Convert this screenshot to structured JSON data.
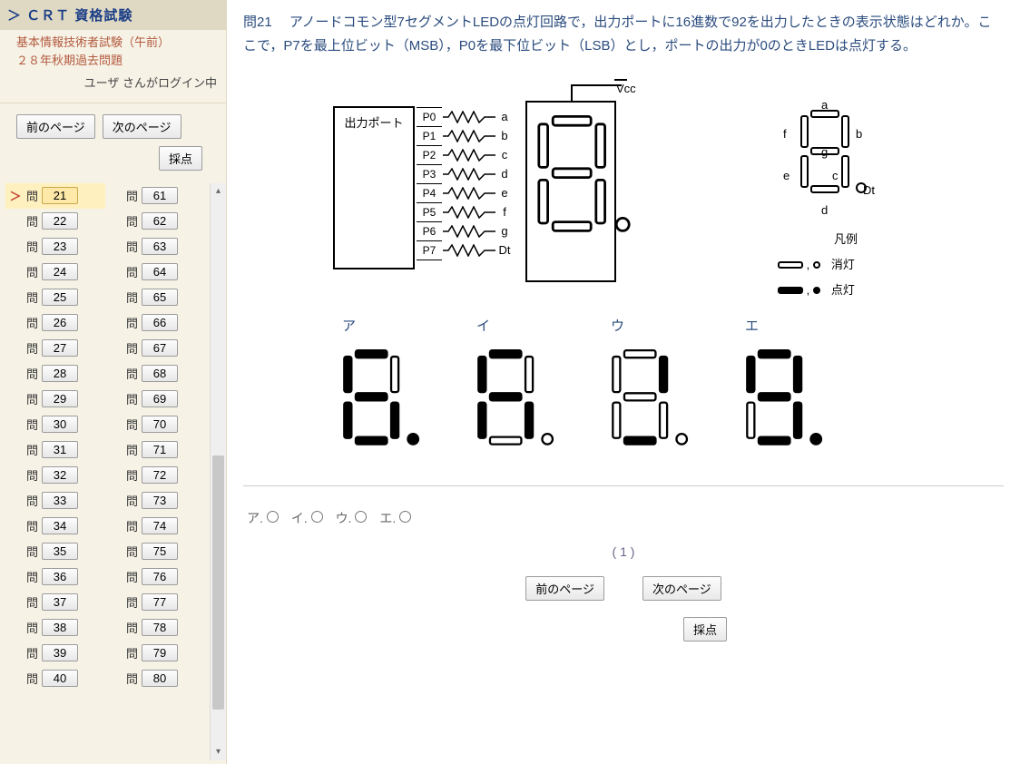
{
  "app": {
    "title": "＞ ＣＲＴ 資格試験"
  },
  "sidebar": {
    "subtitle": "基本情報技術者試験（午前）\n２８年秋期過去問題",
    "login_status": "ユーザ さんがログイン中",
    "prev_label": "前のページ",
    "next_label": "次のページ",
    "score_label": "採点",
    "q_prefix": "問",
    "active_q": 21,
    "col1_start": 21,
    "col1_end": 40,
    "col2_start": 61,
    "col2_end": 80
  },
  "question": {
    "number_label": "問21",
    "text": "アノードコモン型7セグメントLEDの点灯回路で，出力ポートに16進数で92を出力したときの表示状態はどれか。ここで，P7を最上位ビット（MSB），P0を最下位ビット（LSB）とし，ポートの出力が0のときLEDは点灯する。"
  },
  "circuit": {
    "port_label": "出力ポート",
    "vcc_label": "Vcc",
    "pins": [
      "P0",
      "P1",
      "P2",
      "P3",
      "P4",
      "P5",
      "P6",
      "P7"
    ],
    "segs": [
      "a",
      "b",
      "c",
      "d",
      "e",
      "f",
      "g",
      "Dt"
    ],
    "legend_title": "凡例",
    "legend_off": "消灯",
    "legend_on": "点灯",
    "seg_map_labels": {
      "a": "a",
      "b": "b",
      "c": "c",
      "d": "d",
      "e": "e",
      "f": "f",
      "g": "g",
      "dt": "Dt"
    }
  },
  "choices": {
    "labels": [
      "ア",
      "イ",
      "ウ",
      "エ"
    ],
    "patterns": [
      {
        "a": true,
        "b": false,
        "c": true,
        "d": true,
        "e": true,
        "f": true,
        "g": true,
        "dt": true
      },
      {
        "a": true,
        "b": false,
        "c": true,
        "d": false,
        "e": true,
        "f": true,
        "g": true,
        "dt": false
      },
      {
        "a": false,
        "b": true,
        "c": false,
        "d": true,
        "e": false,
        "f": false,
        "g": false,
        "dt": false
      },
      {
        "a": true,
        "b": true,
        "c": true,
        "d": true,
        "e": false,
        "f": true,
        "g": true,
        "dt": true
      }
    ]
  },
  "answer_area": {
    "radio_labels": [
      "ア.",
      "イ.",
      "ウ.",
      "エ."
    ],
    "page_indicator": "( 1 )",
    "prev_label": "前のページ",
    "next_label": "次のページ",
    "score_label": "採点"
  }
}
